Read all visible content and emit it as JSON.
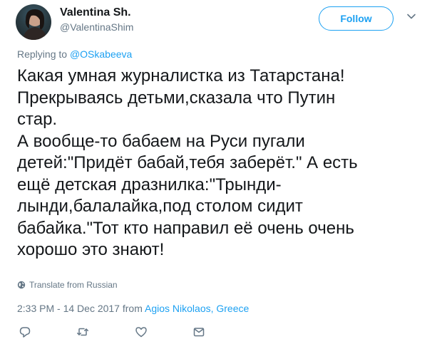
{
  "user": {
    "display_name": "Valentina Sh.",
    "handle": "@ValentinaShim",
    "avatar_icon": "profile-photo"
  },
  "header": {
    "follow_label": "Follow",
    "caret_icon": "chevron-down-icon"
  },
  "reply": {
    "prefix": "Replying to ",
    "mention": "@OSkabeeva"
  },
  "tweet": {
    "text": "Какая умная журналистка из Татарстана!\nПрекрываясь детьми,сказала что Путин\nстар.\nА вообще-то бабаем на Руси пугали\nдетей:\"Придёт бабай,тебя заберёт.\" А есть\nещё детская дразнилка:\"Трынди-\nлынди,балалайка,под столом сидит\nбабайка.\"Тот кто направил её очень очень\nхорошо это знают!"
  },
  "translate": {
    "label": "Translate from Russian",
    "icon": "globe-icon"
  },
  "meta": {
    "timestamp": "2:33 PM - 14 Dec 2017",
    "from_word": " from ",
    "location": "Agios Nikolaos, Greece"
  },
  "actions": {
    "icons": [
      "reply-icon",
      "retweet-icon",
      "like-icon",
      "direct-message-icon"
    ]
  },
  "colors": {
    "accent": "#1da1f2",
    "secondary_text": "#657786",
    "primary_text": "#14171a"
  }
}
